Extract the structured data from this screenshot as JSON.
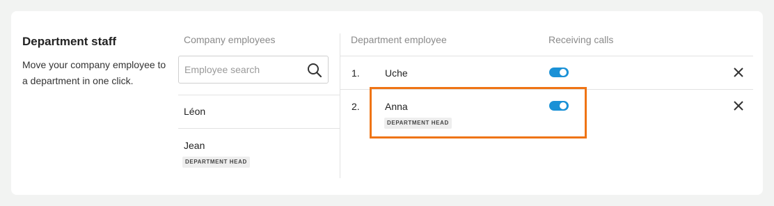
{
  "intro": {
    "title": "Department staff",
    "description": "Move your company employee to a department in one click."
  },
  "company": {
    "header": "Company employees",
    "search": {
      "placeholder": "Employee search",
      "value": ""
    },
    "employees": [
      {
        "name": "Léon",
        "badge": ""
      },
      {
        "name": "Jean",
        "badge": "DEPARTMENT HEAD"
      }
    ]
  },
  "department": {
    "header_employee": "Department employee",
    "header_calls": "Receiving calls",
    "rows": [
      {
        "number": "1.",
        "name": "Uche",
        "badge": "",
        "receiving_calls": true
      },
      {
        "number": "2.",
        "name": "Anna",
        "badge": "DEPARTMENT HEAD",
        "receiving_calls": true
      }
    ]
  },
  "colors": {
    "toggle_on": "#1a91d6",
    "highlight": "#ef7414"
  },
  "icons": {
    "search": "search-icon",
    "remove": "close-icon"
  }
}
